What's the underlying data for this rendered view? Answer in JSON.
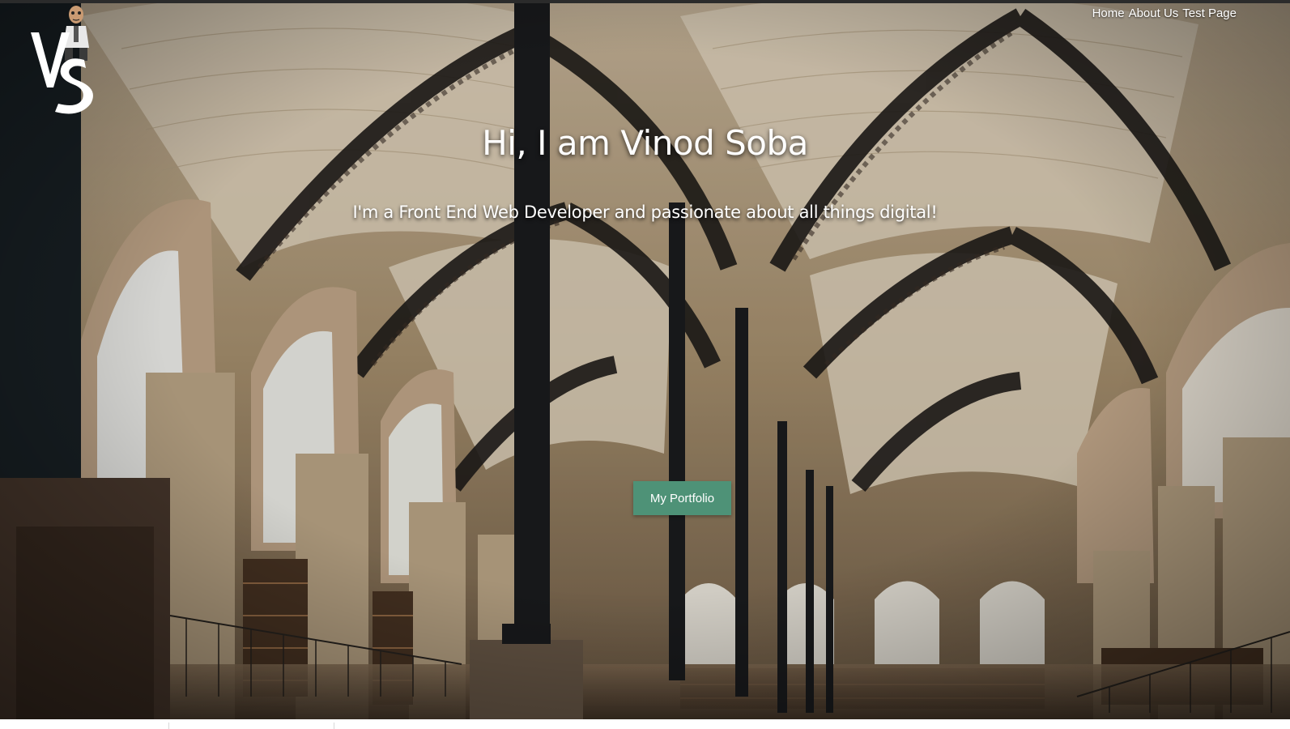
{
  "logo": {
    "text": "VS",
    "mascot": "cartoon-man-icon"
  },
  "nav": {
    "items": [
      {
        "label": "Home"
      },
      {
        "label": "About Us"
      },
      {
        "label": "Test Page"
      }
    ]
  },
  "hero": {
    "headline": "Hi, I am Vinod Soba",
    "tagline": "I'm a Front End Web Developer and passionate about all things digital!",
    "cta_label": "My Portfolio",
    "background": "library-interior-photo"
  },
  "colors": {
    "cta": "#4e9277",
    "text": "#ffffff",
    "topbar": "#2b2b2b"
  }
}
